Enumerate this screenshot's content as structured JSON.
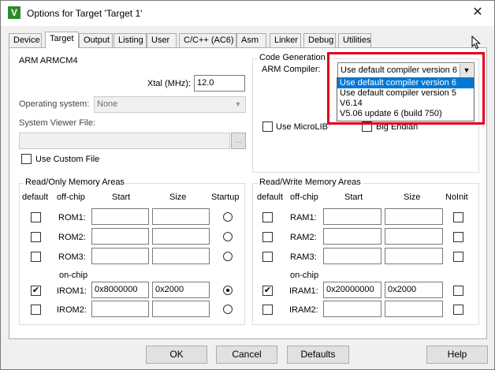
{
  "window": {
    "title": "Options for Target 'Target 1'",
    "app_icon_glyph": "V",
    "close_glyph": "✕"
  },
  "tabs": [
    {
      "label": "Device"
    },
    {
      "label": "Target"
    },
    {
      "label": "Output"
    },
    {
      "label": "Listing"
    },
    {
      "label": "User"
    },
    {
      "label": "C/C++ (AC6)"
    },
    {
      "label": "Asm"
    },
    {
      "label": "Linker"
    },
    {
      "label": "Debug"
    },
    {
      "label": "Utilities"
    }
  ],
  "target": {
    "device_name": "ARM ARMCM4",
    "xtal_label": "Xtal (MHz):",
    "xtal_value": "12.0",
    "os_label": "Operating system:",
    "os_value": "None",
    "svd_label": "System Viewer File:",
    "svd_value": "",
    "browse_label": "...",
    "custom_file_label": "Use Custom File"
  },
  "codegen": {
    "title": "Code Generation",
    "compiler_label": "ARM Compiler:",
    "compiler_value": "Use default compiler version 6",
    "options": [
      "Use default compiler version 6",
      "Use default compiler version 5",
      "V6.14",
      "V5.06 update 6 (build 750)"
    ],
    "microlib_label": "Use MicroLIB",
    "bigendian_label": "Big Endian"
  },
  "rom": {
    "title": "Read/Only Memory Areas",
    "headers": {
      "default": "default",
      "offchip": "off-chip",
      "start": "Start",
      "size": "Size",
      "extra": "Startup"
    },
    "onchip_label": "on-chip",
    "rows": [
      {
        "name": "ROM1:",
        "start": "",
        "size": "",
        "default": false,
        "radio": false
      },
      {
        "name": "ROM2:",
        "start": "",
        "size": "",
        "default": false,
        "radio": false
      },
      {
        "name": "ROM3:",
        "start": "",
        "size": "",
        "default": false,
        "radio": false
      },
      {
        "name": "IROM1:",
        "start": "0x8000000",
        "size": "0x2000",
        "default": true,
        "radio": true
      },
      {
        "name": "IROM2:",
        "start": "",
        "size": "",
        "default": false,
        "radio": false
      }
    ]
  },
  "ram": {
    "title": "Read/Write Memory Areas",
    "headers": {
      "default": "default",
      "offchip": "off-chip",
      "start": "Start",
      "size": "Size",
      "extra": "NoInit"
    },
    "onchip_label": "on-chip",
    "rows": [
      {
        "name": "RAM1:",
        "start": "",
        "size": "",
        "default": false,
        "noinit": false
      },
      {
        "name": "RAM2:",
        "start": "",
        "size": "",
        "default": false,
        "noinit": false
      },
      {
        "name": "RAM3:",
        "start": "",
        "size": "",
        "default": false,
        "noinit": false
      },
      {
        "name": "IRAM1:",
        "start": "0x20000000",
        "size": "0x2000",
        "default": true,
        "noinit": false
      },
      {
        "name": "IRAM2:",
        "start": "",
        "size": "",
        "default": false,
        "noinit": false
      }
    ]
  },
  "buttons": {
    "ok": "OK",
    "cancel": "Cancel",
    "defaults": "Defaults",
    "help": "Help"
  },
  "checkmark_glyph": "✔",
  "colors": {
    "highlight": "#e2001a",
    "selection": "#0078d7"
  }
}
